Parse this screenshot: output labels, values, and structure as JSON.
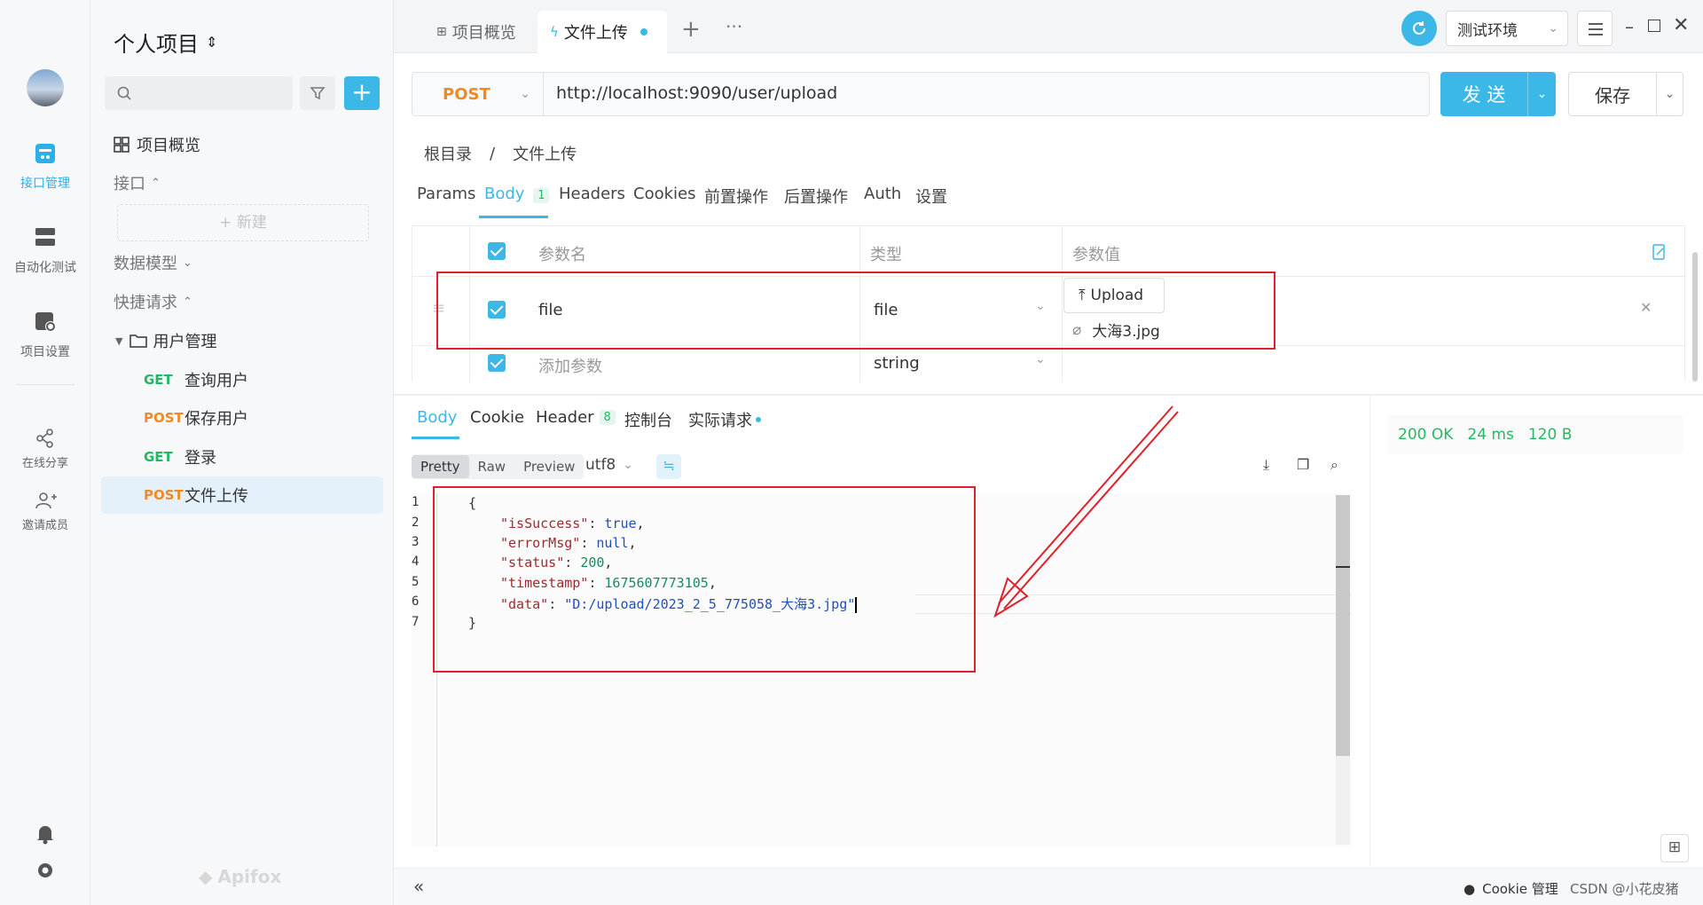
{
  "rail": {
    "items": [
      {
        "label": "接口管理",
        "icon": "api-manage-icon"
      },
      {
        "label": "自动化测试",
        "icon": "automation-test-icon"
      },
      {
        "label": "项目设置",
        "icon": "project-settings-icon"
      },
      {
        "label": "在线分享",
        "icon": "share-icon"
      },
      {
        "label": "邀请成员",
        "icon": "invite-member-icon"
      }
    ]
  },
  "sidebar": {
    "project_title": "个人项目",
    "search_placeholder": "",
    "overview": "项目概览",
    "section_api": "接口",
    "new_label": "+ 新建",
    "section_model": "数据模型",
    "section_quick": "快捷请求",
    "folder": "用户管理",
    "requests": [
      {
        "method": "GET",
        "name": "查询用户"
      },
      {
        "method": "POST",
        "name": "保存用户"
      },
      {
        "method": "GET",
        "name": "登录"
      },
      {
        "method": "POST",
        "name": "文件上传"
      }
    ],
    "brand": "Apifox"
  },
  "tabs": {
    "items": [
      {
        "label": "项目概览"
      },
      {
        "label": "文件上传"
      }
    ],
    "env": "测试环境"
  },
  "request": {
    "method": "POST",
    "url": "http://localhost:9090/user/upload",
    "send": "发 送",
    "save": "保存",
    "breadcrumb_root": "根目录",
    "breadcrumb_sep": "/",
    "breadcrumb_current": "文件上传",
    "subtabs": [
      "Params",
      "Body",
      "Headers",
      "Cookies",
      "前置操作",
      "后置操作",
      "Auth",
      "设置"
    ],
    "body_count": "1"
  },
  "params_table": {
    "headers": [
      "参数名",
      "类型",
      "参数值"
    ],
    "rows": [
      {
        "name": "file",
        "type": "file",
        "upload": "Upload",
        "file_name": "大海3.jpg"
      },
      {
        "name": "添加参数",
        "type": "string"
      }
    ]
  },
  "response": {
    "tabs": [
      "Body",
      "Cookie",
      "Header",
      "控制台",
      "实际请求"
    ],
    "header_count": "8",
    "formats": [
      "Pretty",
      "Raw",
      "Preview"
    ],
    "encoding": "utf8",
    "status": "200 OK",
    "time": "24 ms",
    "size": "120 B",
    "code_lines": [
      {
        "n": "1",
        "text": "{"
      },
      {
        "n": "2",
        "key": "\"isSuccess\"",
        "val": "true",
        "vtype": "bool",
        "comma": ","
      },
      {
        "n": "3",
        "key": "\"errorMsg\"",
        "val": "null",
        "vtype": "bool",
        "comma": ","
      },
      {
        "n": "4",
        "key": "\"status\"",
        "val": "200",
        "vtype": "num",
        "comma": ","
      },
      {
        "n": "5",
        "key": "\"timestamp\"",
        "val": "1675607773105",
        "vtype": "num",
        "comma": ","
      },
      {
        "n": "6",
        "key": "\"data\"",
        "val": "\"D:/upload/2023_2_5_775058_大海3.jpg\"",
        "vtype": "str",
        "comma": ""
      },
      {
        "n": "7",
        "text": "}"
      }
    ]
  },
  "footer": {
    "cookie": "Cookie 管理",
    "watermark": "CSDN @小花皮猪"
  },
  "colors": {
    "accent": "#3bb8e8",
    "get": "#25b864",
    "post": "#f08a24",
    "annotation": "#e0202a"
  }
}
